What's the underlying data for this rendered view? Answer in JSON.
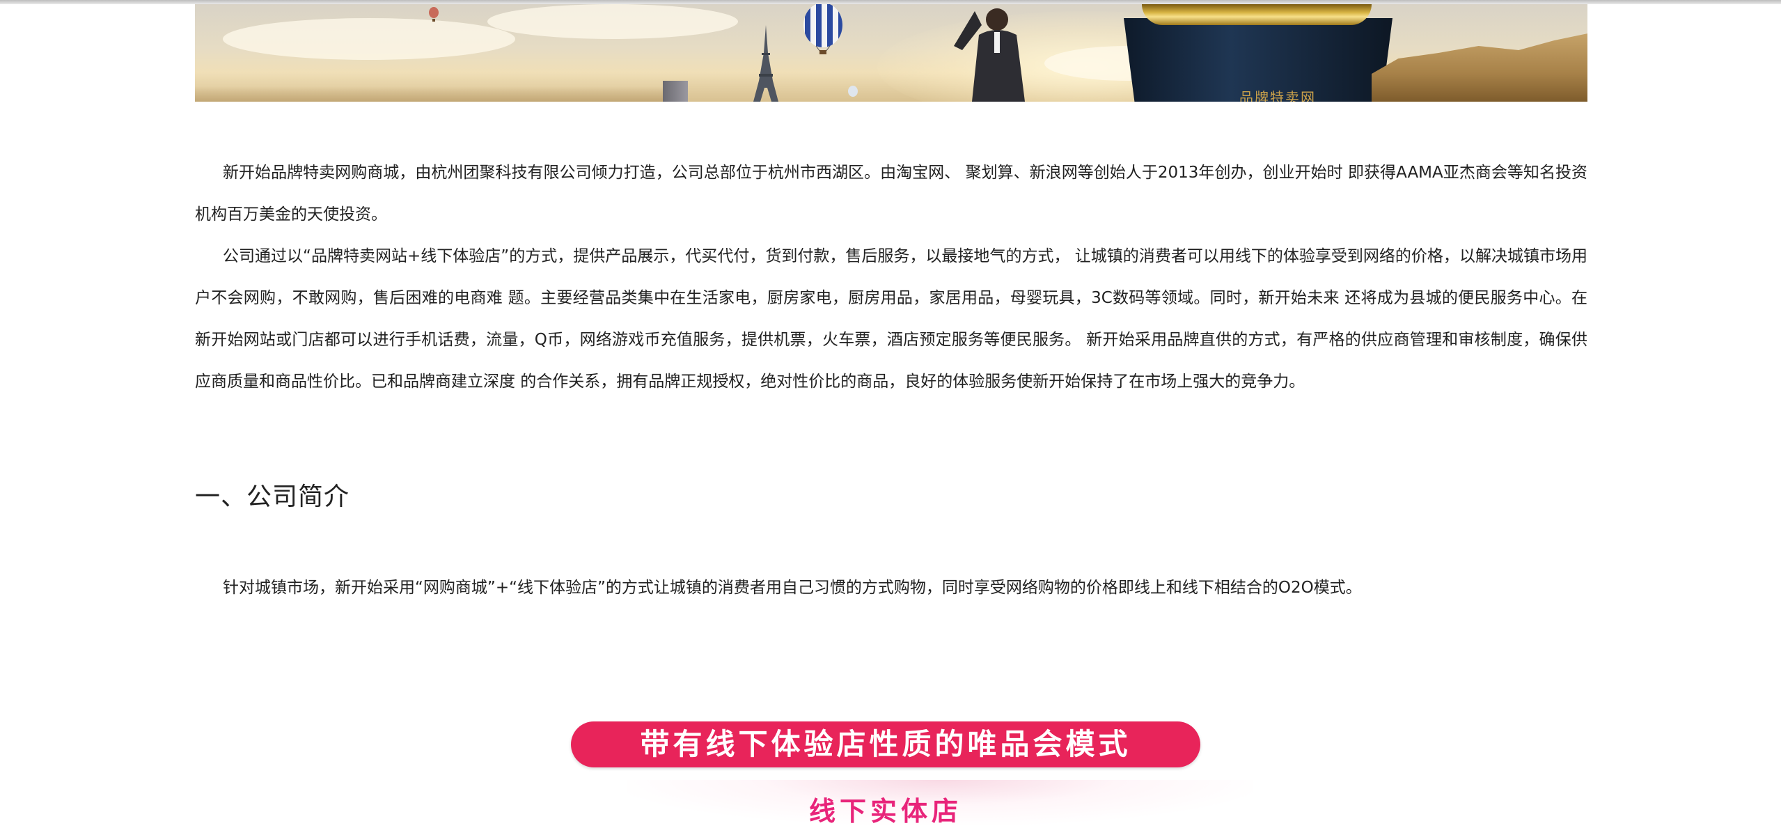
{
  "banner": {
    "plate_text": "品牌特卖网"
  },
  "intro": {
    "paragraph_1": "新开始品牌特卖网购商城，由杭州团聚科技有限公司倾力打造，公司总部位于杭州市西湖区。由淘宝网、 聚划算、新浪网等创始人于2013年创办，创业开始时 即获得AAMA亚杰商会等知名投资机构百万美金的天使投资。",
    "paragraph_2": "公司通过以“品牌特卖网站+线下体验店”的方式，提供产品展示，代买代付，货到付款，售后服务，以最接地气的方式， 让城镇的消费者可以用线下的体验享受到网络的价格，以解决城镇市场用户不会网购，不敢网购，售后困难的电商难 题。主要经营品类集中在生活家电，厨房家电，厨房用品，家居用品，母婴玩具，3C数码等领域。同时，新开始未来 还将成为县城的便民服务中心。在新开始网站或门店都可以进行手机话费，流量，Q币，网络游戏币充值服务，提供机票，火车票，酒店预定服务等便民服务。 新开始采用品牌直供的方式，有严格的供应商管理和审核制度，确保供应商质量和商品性价比。已和品牌商建立深度 的合作关系，拥有品牌正规授权，绝对性价比的商品，良好的体验服务使新开始保持了在市场上强大的竞争力。"
  },
  "section_1": {
    "title": "一、公司简介",
    "paragraph": "针对城镇市场，新开始采用“网购商城”+“线下体验店”的方式让城镇的消费者用自己习惯的方式购物，同时享受网络购物的价格即线上和线下相结合的O2O模式。"
  },
  "infographic": {
    "pill_label": "带有线下体验店性质的唯品会模式",
    "sub_heading": "线下实体店",
    "pill_color": "#e8245a",
    "sub_heading_color": "#e8247a"
  }
}
